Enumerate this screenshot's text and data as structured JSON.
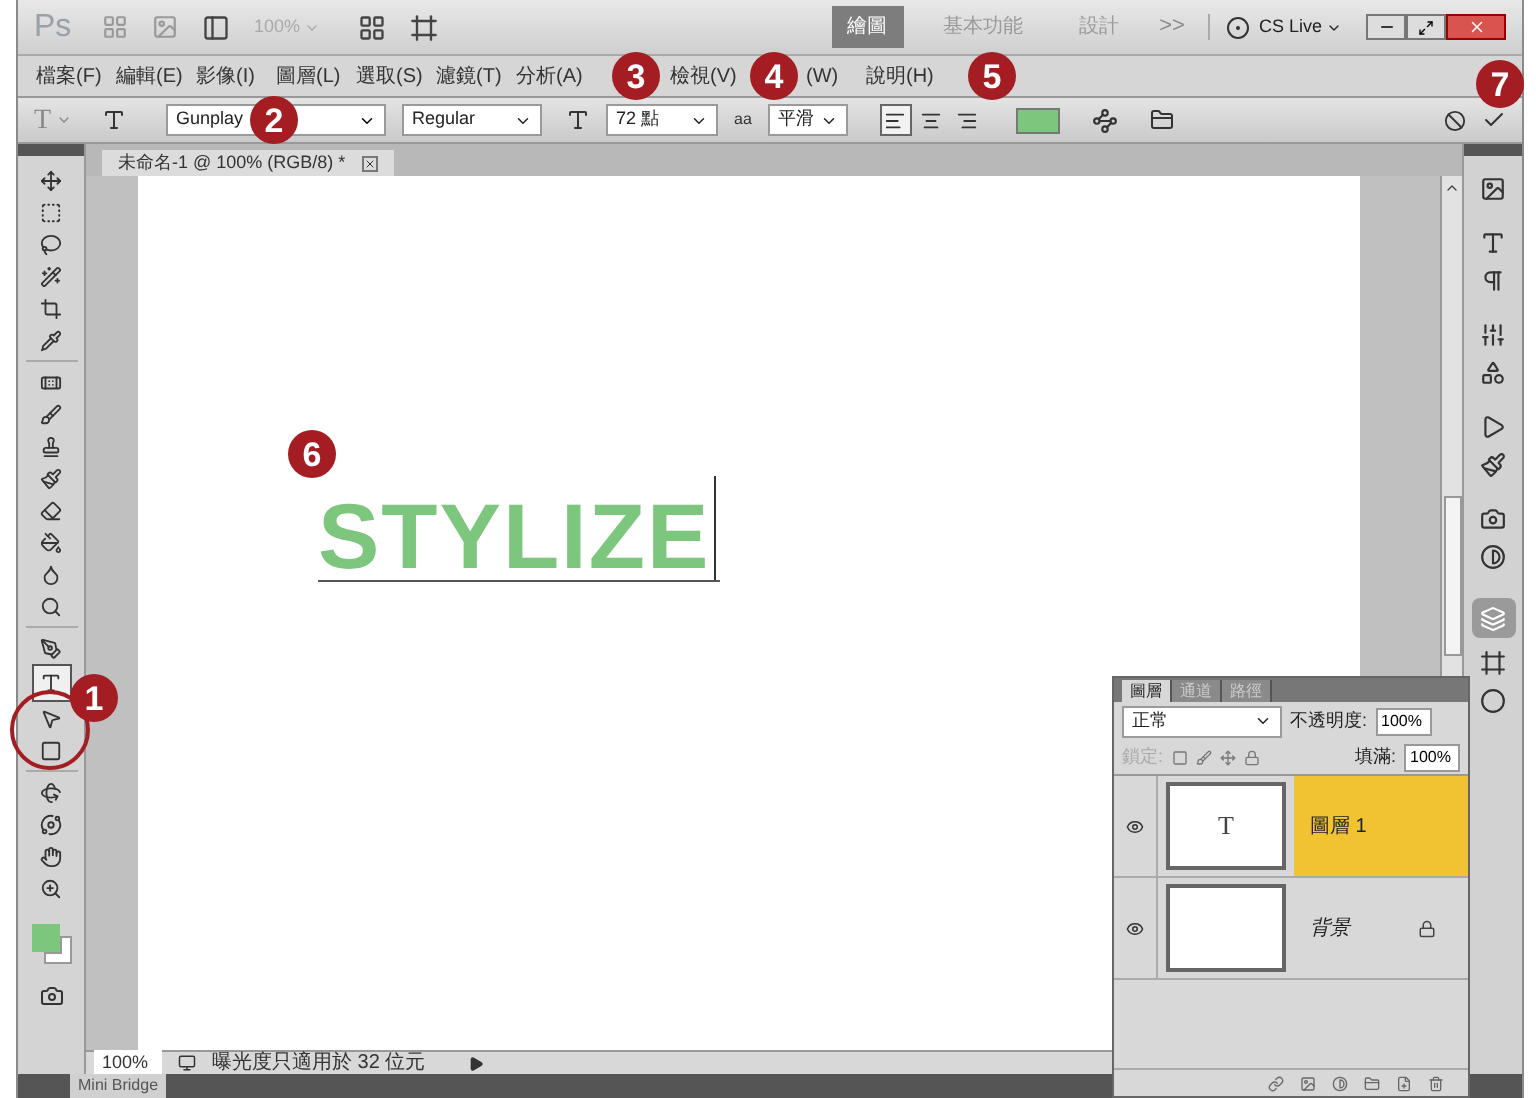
{
  "title_bar": {
    "logo": "Ps",
    "zoom": "100%",
    "workspaces": [
      {
        "label": "繪圖",
        "selected": true
      },
      {
        "label": "基本功能",
        "selected": false
      },
      {
        "label": "設計",
        "selected": false
      }
    ],
    "more": ">>",
    "cs_live": "CS Live"
  },
  "menu": [
    "檔案(F)",
    "編輯(E)",
    "影像(I)",
    "圖層(L)",
    "選取(S)",
    "濾鏡(T)",
    "分析(A)",
    "檢視(V)",
    "(W)",
    "說明(H)"
  ],
  "options": {
    "tool_preset": "T",
    "font_family": "Gunplay",
    "font_style": "Regular",
    "font_size": "72 點",
    "antialias_glyph": "aa",
    "antialias": "平滑",
    "align": [
      {
        "kind": "left",
        "selected": true
      },
      {
        "kind": "center",
        "selected": false
      },
      {
        "kind": "right",
        "selected": false
      }
    ]
  },
  "document_tab": {
    "title": "未命名-1 @ 100% (RGB/8) *"
  },
  "canvas_text": "STYLIZE",
  "tools": [
    {
      "kind": "move",
      "selected": false
    },
    {
      "kind": "marquee",
      "selected": false
    },
    {
      "kind": "lasso",
      "selected": false
    },
    {
      "kind": "quick-select",
      "selected": false
    },
    {
      "kind": "crop",
      "selected": false
    },
    {
      "kind": "eyedropper",
      "selected": false
    },
    {
      "kind": "healing",
      "selected": false
    },
    {
      "kind": "brush",
      "selected": false
    },
    {
      "kind": "stamp",
      "selected": false
    },
    {
      "kind": "history-brush",
      "selected": false
    },
    {
      "kind": "eraser",
      "selected": false
    },
    {
      "kind": "bucket",
      "selected": false
    },
    {
      "kind": "blur",
      "selected": false
    },
    {
      "kind": "dodge",
      "selected": false
    },
    {
      "kind": "pen",
      "selected": false
    },
    {
      "kind": "type",
      "selected": true
    },
    {
      "kind": "path-select",
      "selected": false
    },
    {
      "kind": "shape",
      "selected": false
    },
    {
      "kind": "rotate-3d",
      "selected": false
    },
    {
      "kind": "orbit-3d",
      "selected": false
    },
    {
      "kind": "hand",
      "selected": false
    },
    {
      "kind": "zoom",
      "selected": false
    }
  ],
  "status_bar": {
    "zoom": "100%",
    "message": "曝光度只適用於 32 位元"
  },
  "mini_bridge": "Mini Bridge",
  "layers_panel": {
    "tabs": [
      {
        "label": "圖層",
        "selected": true
      },
      {
        "label": "通道",
        "selected": false
      },
      {
        "label": "路徑",
        "selected": false
      }
    ],
    "blend_mode": "正常",
    "opacity_label": "不透明度:",
    "opacity": "100%",
    "lock_label": "鎖定:",
    "fill_label": "填滿:",
    "fill": "100%",
    "layers": [
      {
        "name": "圖層 1",
        "kind": "text",
        "thumb": "T",
        "selected": true,
        "visible": true,
        "locked": false
      },
      {
        "name": "背景",
        "kind": "background",
        "selected": false,
        "visible": true,
        "locked": true
      }
    ]
  },
  "callouts": [
    "1",
    "2",
    "3",
    "4",
    "5",
    "6",
    "7"
  ]
}
